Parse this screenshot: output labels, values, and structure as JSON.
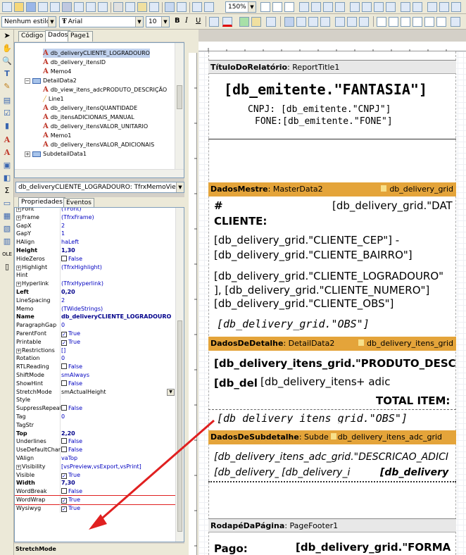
{
  "toolbar": {
    "zoom": "150%",
    "style": "Nenhum estilo",
    "font": "Arial",
    "size": "10",
    "bold": "B",
    "italic": "I",
    "underline": "U"
  },
  "left_tabs": {
    "code": "Código",
    "data": "Dados",
    "page": "Page1"
  },
  "tree": [
    {
      "label": "db_deliveryCLIENTE_LOGRADOURO",
      "icon": "A",
      "indent": 40,
      "selected": true
    },
    {
      "label": "db_delivery_itensID",
      "icon": "A",
      "indent": 40
    },
    {
      "label": "Memo4",
      "icon": "A",
      "indent": 40
    },
    {
      "label": "DetailData2",
      "icon": "band",
      "indent": 14,
      "expand": "−"
    },
    {
      "label": "db_view_itens_adcPRODUTO_DESCRIÇÃO",
      "icon": "A",
      "indent": 40
    },
    {
      "label": "Line1",
      "icon": "line",
      "indent": 40
    },
    {
      "label": "db_delivery_itensQUANTIDADE",
      "icon": "A",
      "indent": 40
    },
    {
      "label": "db_itensADICIONAIS_MANUAL",
      "icon": "A",
      "indent": 40
    },
    {
      "label": "db_delivery_itensVALOR_UNITARIO",
      "icon": "A",
      "indent": 40
    },
    {
      "label": "Memo1",
      "icon": "A",
      "indent": 40
    },
    {
      "label": "db_delivery_itensVALOR_ADICIONAIS",
      "icon": "A",
      "indent": 40
    },
    {
      "label": "SubdetailData1",
      "icon": "band",
      "indent": 14,
      "expand": "+"
    }
  ],
  "object_selector": "db_deliveryCLIENTE_LOGRADOURO: TfrxMemoView",
  "prop_tabs": {
    "props": "Propriedades",
    "events": "Eventos"
  },
  "props": [
    {
      "name": "Font",
      "value": "(TFont)",
      "expand": "+",
      "partial": true
    },
    {
      "name": "Frame",
      "value": "(TfrxFrame)",
      "expand": "+"
    },
    {
      "name": "GapX",
      "value": "2"
    },
    {
      "name": "GapY",
      "value": "1"
    },
    {
      "name": "HAlign",
      "value": "haLeft"
    },
    {
      "name": "Height",
      "value": "1,30",
      "bold": true
    },
    {
      "name": "HideZeros",
      "value": "False",
      "check": false
    },
    {
      "name": "Highlight",
      "value": "(TfrxHighlight)",
      "expand": "+"
    },
    {
      "name": "Hint",
      "value": ""
    },
    {
      "name": "Hyperlink",
      "value": "(TfrxHyperlink)",
      "expand": "+"
    },
    {
      "name": "Left",
      "value": "0,20",
      "bold": true
    },
    {
      "name": "LineSpacing",
      "value": "2"
    },
    {
      "name": "Memo",
      "value": "(TWideStrings)"
    },
    {
      "name": "Name",
      "value": "db_deliveryCLIENTE_LOGRADOURO",
      "bold": true
    },
    {
      "name": "ParagraphGap",
      "value": "0"
    },
    {
      "name": "ParentFont",
      "value": "True",
      "check": true
    },
    {
      "name": "Printable",
      "value": "True",
      "check": true
    },
    {
      "name": "Restrictions",
      "value": "[]",
      "expand": "+"
    },
    {
      "name": "Rotation",
      "value": "0"
    },
    {
      "name": "RTLReading",
      "value": "False",
      "check": false
    },
    {
      "name": "ShiftMode",
      "value": "smAlways"
    },
    {
      "name": "ShowHint",
      "value": "False",
      "check": false
    },
    {
      "name": "StretchMode",
      "value": "smActualHeight",
      "black": true,
      "dropdown": true
    },
    {
      "name": "Style",
      "value": ""
    },
    {
      "name": "SuppressRepeated",
      "value": "False",
      "check": false
    },
    {
      "name": "Tag",
      "value": "0"
    },
    {
      "name": "TagStr",
      "value": ""
    },
    {
      "name": "Top",
      "value": "2,20",
      "bold": true
    },
    {
      "name": "Underlines",
      "value": "False",
      "check": false
    },
    {
      "name": "UseDefaultCharset",
      "value": "False",
      "check": false
    },
    {
      "name": "VAlign",
      "value": "vaTop"
    },
    {
      "name": "Visibility",
      "value": "[vsPreview,vsExport,vsPrint]",
      "expand": "+"
    },
    {
      "name": "Visible",
      "value": "True",
      "check": true
    },
    {
      "name": "Width",
      "value": "7,30",
      "bold": true
    },
    {
      "name": "WordBreak",
      "value": "False",
      "check": false
    },
    {
      "name": "WordWrap",
      "value": "True",
      "check": true,
      "highlight": true
    },
    {
      "name": "Wysiwyg",
      "value": "True",
      "check": true
    }
  ],
  "hint": "StretchMode",
  "report": {
    "title_band": {
      "name": "TítuloDoRelatório",
      "id": "ReportTitle1"
    },
    "title_fantasia": "[db_emitente.\"FANTASIA\"]",
    "cnpj": "CNPJ: [db_emitente.\"CNPJ\"]",
    "fone": "FONE:[db_emitente.\"FONE\"]",
    "master_band": {
      "name": "DadosMestre",
      "id": "MasterData2",
      "ds": "db_delivery_grid"
    },
    "hash": "#",
    "dat": "[db_delivery_grid.\"DAT",
    "cliente": "CLIENTE:",
    "cep": "[db_delivery_grid.\"CLIENTE_CEP\"] -",
    "bairro": "[db_delivery_grid.\"CLIENTE_BAIRRO\"]",
    "logradouro": "[db_delivery_grid.\"CLIENTE_LOGRADOURO\"",
    "numero": "], [db_delivery_grid.\"CLIENTE_NUMERO\"]",
    "obs_cli": "[db_delivery_grid.\"CLIENTE_OBS\"]",
    "obs": "[db_delivery_grid.\"OBS\"]",
    "detail_band": {
      "name": "DadosDeDetalhe",
      "id": "DetailData2",
      "ds": "db_delivery_itens_grid"
    },
    "prod": "[db_delivery_itens_grid.\"PRODUTO_DESC",
    "del": "[db_del",
    "itens": "[db_delivery_itens",
    "adic": "+ adic",
    "total": "TOTAL ITEM:",
    "obs2": "[db_delivery_itens_grid.\"OBS\"]",
    "sub_band": {
      "name": "DadosDeSubdetalhe",
      "id": "Subde",
      "ds": "db_delivery_itens_adc_grid"
    },
    "descr": "[db_delivery_itens_adc_grid.\"DESCRICAO_ADICI",
    "s1": "[db_delivery_i",
    "s2": "[db_delivery_it",
    "s3": "[db_delivery",
    "footer_band": {
      "name": "RodapéDaPágina",
      "id": "PageFooter1"
    },
    "pago": "Pago:",
    "forma": "[db_delivery_grid.\"FORMA"
  }
}
